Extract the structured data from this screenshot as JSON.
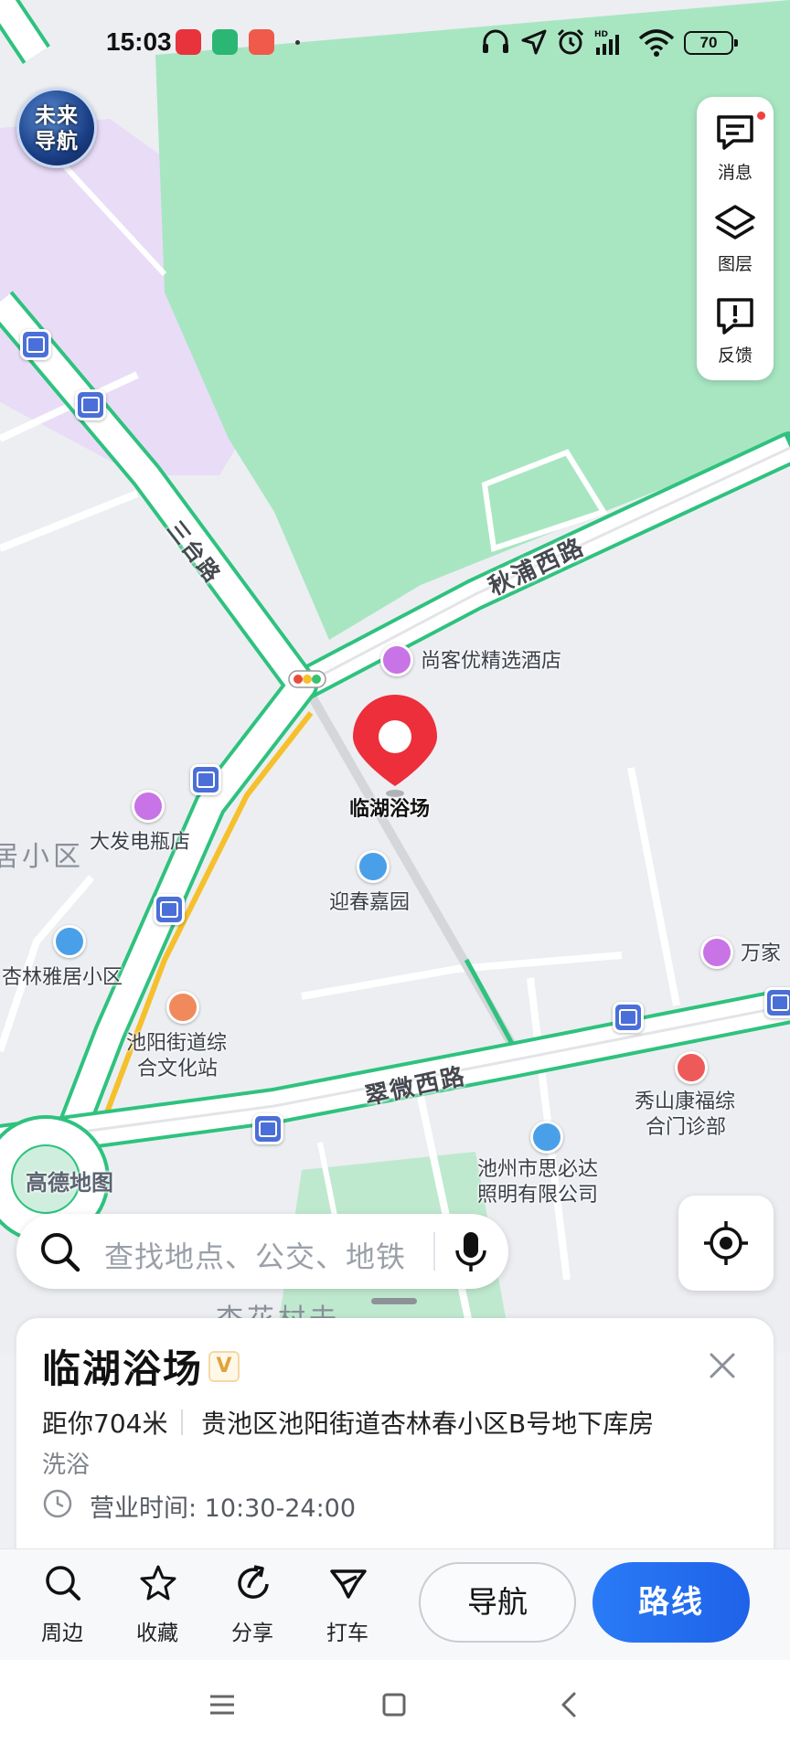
{
  "status_bar": {
    "time": "15:03",
    "battery": "70",
    "icons": [
      "netease-music-icon",
      "video-app-icon",
      "pig-app-icon",
      "headphones-icon",
      "location-arrow-icon",
      "alarm-icon",
      "signal-hd-icon",
      "wifi-icon"
    ]
  },
  "app_logo": {
    "line1": "未来",
    "line2": "导航"
  },
  "tools": {
    "messages": "消息",
    "layers": "图层",
    "feedback": "反馈"
  },
  "map": {
    "roads": {
      "qiupu_west": "秋浦西路",
      "cuiwei_west": "翠微西路",
      "sanhe": "三台路"
    },
    "pois": {
      "hotel": "尚客优精选酒店",
      "selected": "临湖浴场",
      "yingchun": "迎春嘉园",
      "dafa": "大发电瓶店",
      "xinglin_yaju": "杏林雅居小区",
      "chiyang_center_1": "池阳街道综",
      "chiyang_center_2": "合文化站",
      "wanjia": "万家",
      "xiushan_1": "秀山康福综",
      "xiushan_2": "合门诊部",
      "sibida_1": "池州市思必达",
      "sibida_2": "照明有限公司",
      "partial_area": "居小区",
      "partial_village": "杏花村去"
    },
    "watermark": "高德地图"
  },
  "search": {
    "placeholder": "查找地点、公交、地铁"
  },
  "place": {
    "title": "临湖浴场",
    "badge": "V",
    "distance": "距你704米",
    "address": "贵池区池阳街道杏林春小区B号地下库房",
    "category": "洗浴",
    "hours": "营业时间: 10:30-24:00"
  },
  "actions": {
    "nearby": "周边",
    "favorite": "收藏",
    "share": "分享",
    "taxi": "打车",
    "navigate": "导航",
    "route": "路线"
  },
  "colors": {
    "park_green": "#a8e6c2",
    "road_green": "#2ec27e",
    "road_yellow": "#f5c02b",
    "route_blue": "#1e62e8",
    "pin_red": "#ec2f3b"
  }
}
